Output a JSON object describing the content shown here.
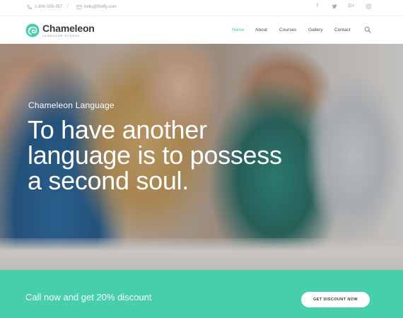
{
  "topbar": {
    "phone": "1-800-555-357",
    "separator": "/",
    "email": "hello@firefly.com",
    "phone_icon": "phone-icon",
    "email_icon": "mail-icon",
    "socials": [
      {
        "icon": "facebook-icon",
        "glyph": "f"
      },
      {
        "icon": "twitter-icon",
        "glyph": "🐦"
      },
      {
        "icon": "google-plus-icon",
        "glyph": "G+"
      },
      {
        "icon": "instagram-icon",
        "glyph": "◎"
      }
    ]
  },
  "nav": {
    "brand": "Chameleon",
    "brand_sub": "LANGUAGE SCHOOL",
    "items": [
      {
        "label": "Home",
        "active": true
      },
      {
        "label": "About",
        "active": false
      },
      {
        "label": "Courses",
        "active": false
      },
      {
        "label": "Gallery",
        "active": false
      },
      {
        "label": "Contact",
        "active": false
      }
    ],
    "search_icon": "search-icon"
  },
  "hero": {
    "eyebrow": "Chameleon Language",
    "headline_lines": [
      "To have another",
      "language is to possess",
      "a second soul."
    ]
  },
  "cta": {
    "text": "Call now and get 20% discount",
    "button": "GET DISCOUNT NOW"
  },
  "colors": {
    "accent": "#45cfab",
    "active_nav": "#3ec9a7",
    "text_dark": "#333a40"
  }
}
